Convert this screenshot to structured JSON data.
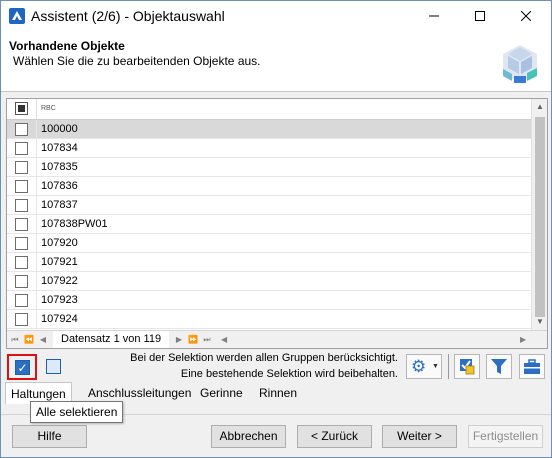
{
  "window": {
    "title": "Assistent (2/6) - Objektauswahl",
    "minimize": "—",
    "maximize": "☐",
    "close": "✕"
  },
  "header": {
    "title": "Vorhandene Objekte",
    "subtitle": "Wählen Sie die zu bearbeitenden Objekte aus."
  },
  "grid": {
    "column_header_icon": "RBC",
    "rows": [
      "100000",
      "107834",
      "107835",
      "107836",
      "107837",
      "107838PW01",
      "107920",
      "107921",
      "107922",
      "107923",
      "107924"
    ],
    "selected_row_index": 0,
    "record_info": "Datensatz 1 von 119"
  },
  "selection": {
    "info_line1": "Bei der Selektion werden allen Gruppen berücksichtigt.",
    "info_line2": "Eine bestehende Selektion wird beibehalten."
  },
  "tabs": [
    "Haltungen",
    "Anschlussleitungen",
    "Gerinne",
    "Rinnen"
  ],
  "active_tab": 0,
  "tooltip": "Alle selektieren",
  "buttons": {
    "help": "Hilfe",
    "cancel": "Abbrechen",
    "back": "< Zurück",
    "next": "Weiter >",
    "finish": "Fertigstellen"
  },
  "colors": {
    "accent": "#2a6fc4",
    "highlight_border": "#dd1111",
    "selected_row": "#d9d9d9"
  }
}
